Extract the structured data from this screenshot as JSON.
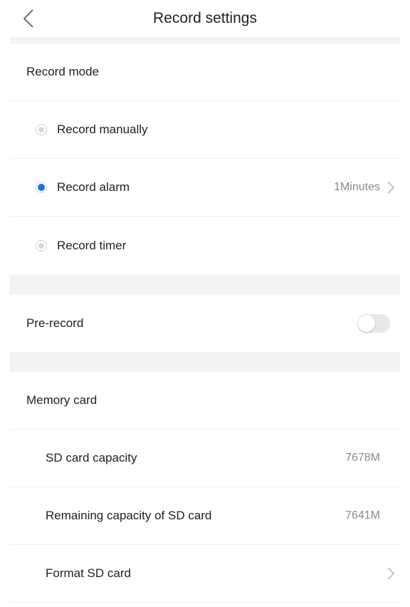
{
  "header": {
    "title": "Record settings"
  },
  "record_mode": {
    "label": "Record mode",
    "options": [
      {
        "label": "Record manually",
        "selected": false
      },
      {
        "label": "Record alarm",
        "selected": true,
        "value": "1Minutes"
      },
      {
        "label": "Record timer",
        "selected": false
      }
    ]
  },
  "pre_record": {
    "label": "Pre-record",
    "enabled": false
  },
  "memory_card": {
    "label": "Memory card",
    "sd_capacity": {
      "label": "SD card capacity",
      "value": "7678M"
    },
    "remaining": {
      "label": "Remaining capacity of SD card",
      "value": "7641M"
    },
    "format": {
      "label": "Format SD card"
    }
  },
  "colors": {
    "accent": "#1a73e8",
    "divider": "#efefef",
    "section_gap": "#f3f3f3"
  },
  "icons": {
    "back": "chevron-left-icon",
    "forward": "chevron-right-icon"
  }
}
